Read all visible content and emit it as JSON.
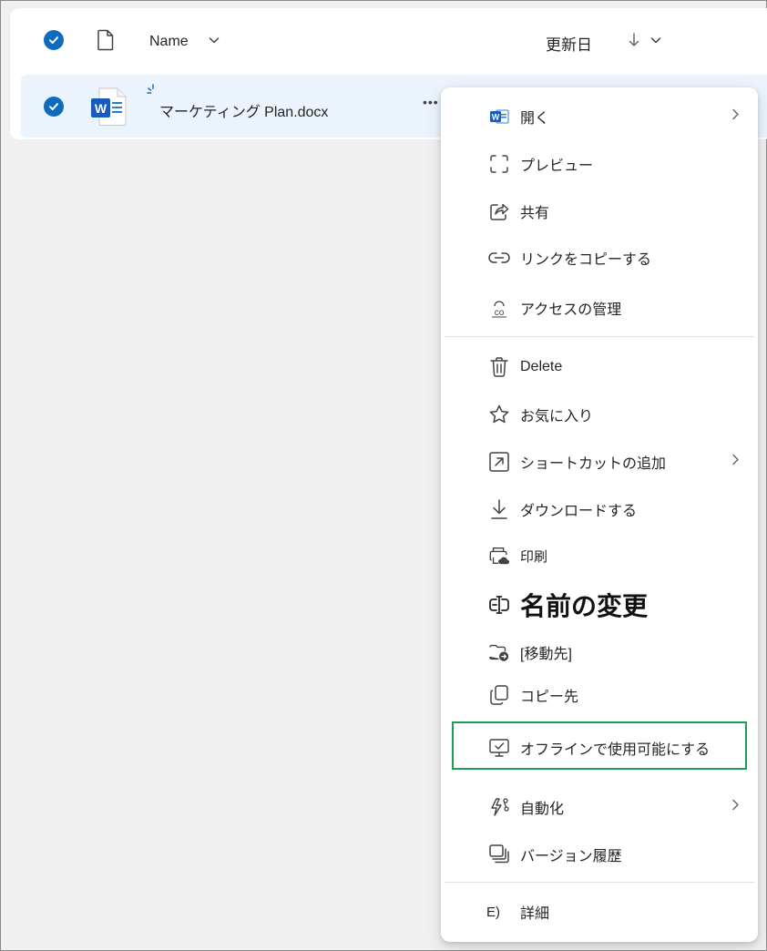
{
  "header": {
    "name_label": "Name",
    "modified_label": "更新日"
  },
  "file": {
    "name": "マーケティング Plan.docx",
    "more": "•••"
  },
  "menu": {
    "open": "開く",
    "preview": "プレビュー",
    "share": "共有",
    "copy_link": "リンクをコピーする",
    "manage_access": "アクセスの管理",
    "delete": "Delete",
    "favorite": "お気に入り",
    "add_shortcut": "ショートカットの追加",
    "download": "ダウンロードする",
    "print": "印刷",
    "rename": "名前の変更",
    "move_to": "[移動先]",
    "copy_to": "コピー先",
    "make_offline": "オフラインで使用可能にする",
    "automate": "自動化",
    "version_history": "バージョン履歴",
    "details_prefix": "E)",
    "details": "詳細"
  },
  "colors": {
    "accent": "#0f6cbd",
    "row_selected": "#ebf3fc",
    "highlight": "#1f9d55",
    "word_blue": "#185abd"
  }
}
